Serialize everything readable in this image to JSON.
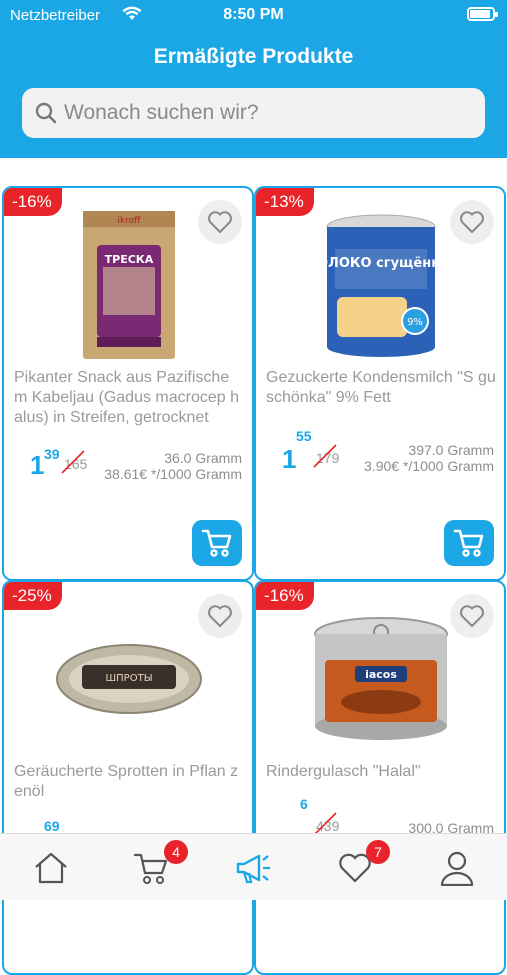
{
  "status": {
    "carrier": "Netzbetreiber",
    "time": "8:50 PM"
  },
  "header": {
    "title": "Ermäßigte Produkte"
  },
  "search": {
    "placeholder": "Wonach suchen wir?"
  },
  "colors": {
    "accent": "#1ba7e6",
    "discount": "#e8242a"
  },
  "products": [
    {
      "discount": "-16%",
      "name": "Pikanter Snack aus Pazifische m Kabeljau (Gadus macrocep halus) in Streifen, getrocknet",
      "price_main": "1",
      "price_cents": "39",
      "old_price": "165",
      "weight": "36.0 Gramm",
      "per_unit": "38.61€ */1000 Gramm",
      "image_label": "ТРЕСКА"
    },
    {
      "discount": "-13%",
      "name": "Gezuckerte Kondensmilch \"S guschönka\" 9% Fett",
      "price_main": "1",
      "price_cents": "55",
      "old_price": "179",
      "weight": "397.0 Gramm",
      "per_unit": "3.90€ */1000 Gramm",
      "image_label": "МОЛОКО сгущённое"
    },
    {
      "discount": "-25%",
      "name": "Geräucherte Sprotten in Pflan zenöl",
      "price_cents": "69",
      "image_label": "ШПРОТЫ"
    },
    {
      "discount": "-16%",
      "name": "Rindergulasch \"Halal\"",
      "price_cents": "6",
      "old_price": "439",
      "weight": "300.0 Gramm",
      "image_label": "iacos"
    }
  ],
  "tabbar": {
    "cart_count": "4",
    "favorites_count": "7",
    "icons": [
      "home-icon",
      "cart-icon",
      "megaphone-icon",
      "heart-icon",
      "profile-icon"
    ]
  }
}
